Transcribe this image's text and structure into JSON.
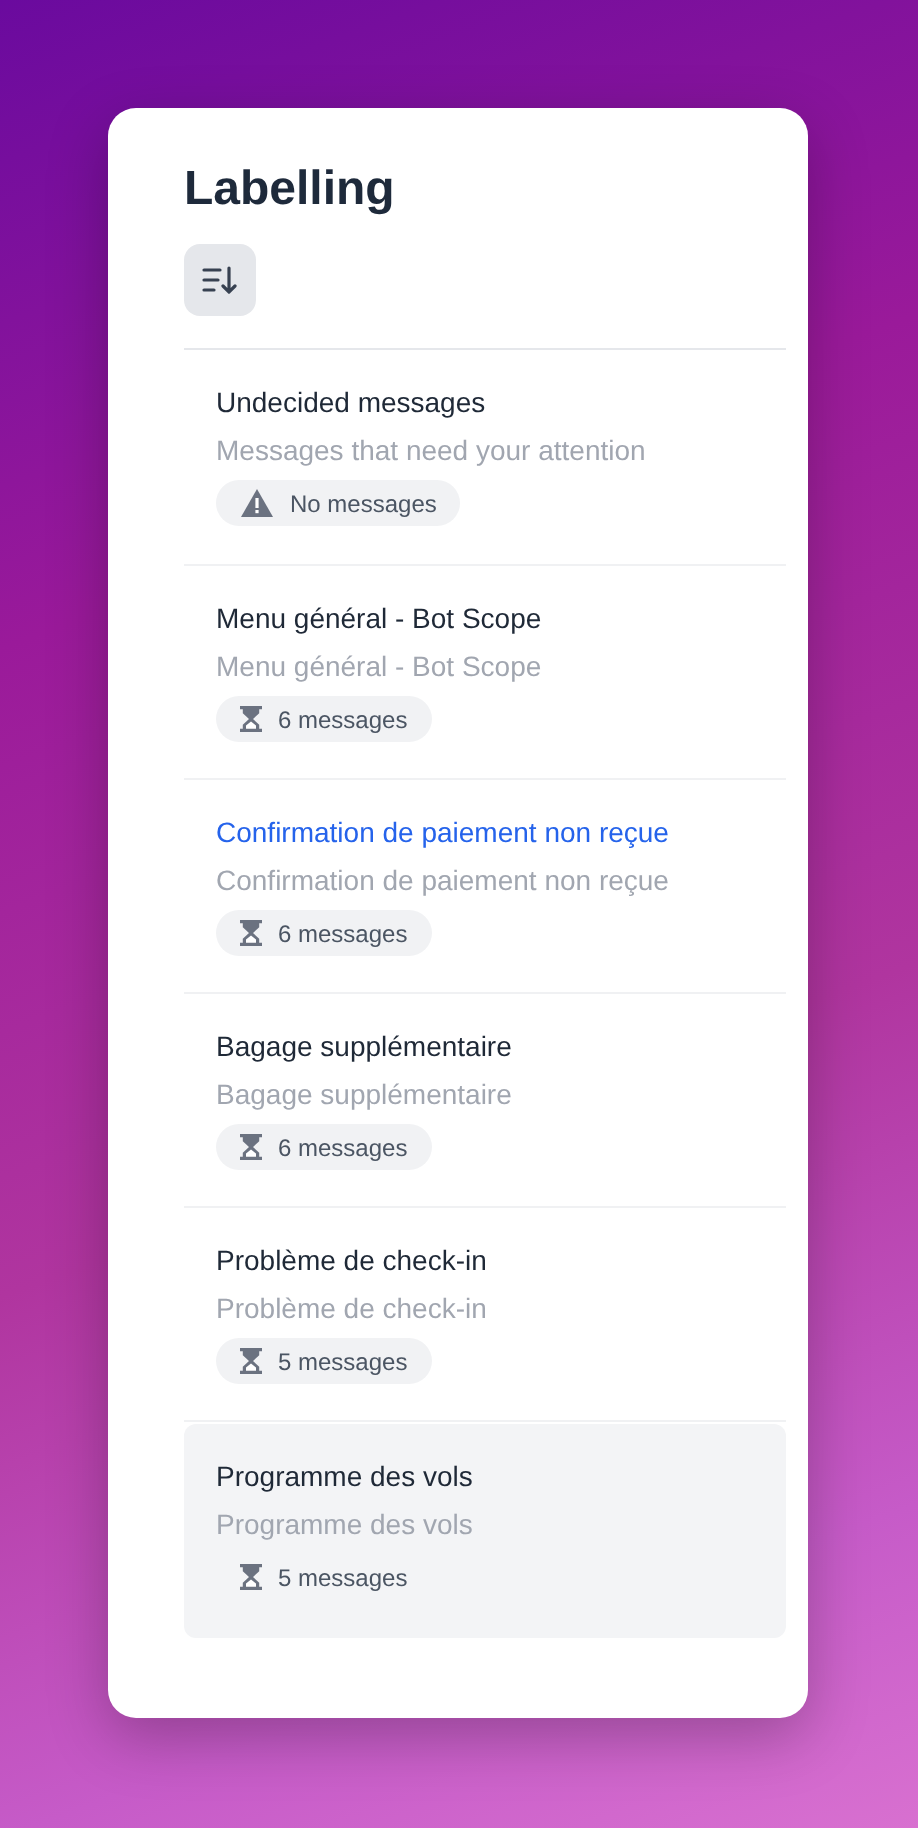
{
  "title": "Labelling",
  "items": [
    {
      "title": "Undecided messages",
      "subtitle": "Messages that need your attention",
      "badge": {
        "kind": "warning",
        "text": "No messages"
      },
      "selected": false,
      "hovered": false
    },
    {
      "title": "Menu général - Bot Scope",
      "subtitle": "Menu général - Bot Scope",
      "badge": {
        "kind": "pending",
        "text": "6 messages"
      },
      "selected": false,
      "hovered": false
    },
    {
      "title": "Confirmation de paiement non reçue",
      "subtitle": "Confirmation de paiement non reçue",
      "badge": {
        "kind": "pending",
        "text": "6 messages"
      },
      "selected": true,
      "hovered": false
    },
    {
      "title": "Bagage supplémentaire",
      "subtitle": "Bagage supplémentaire",
      "badge": {
        "kind": "pending",
        "text": "6 messages"
      },
      "selected": false,
      "hovered": false
    },
    {
      "title": "Problème de check-in",
      "subtitle": "Problème de check-in",
      "badge": {
        "kind": "pending",
        "text": "5 messages"
      },
      "selected": false,
      "hovered": false
    },
    {
      "title": "Programme des vols",
      "subtitle": "Programme des vols",
      "badge": {
        "kind": "pending",
        "text": "5 messages"
      },
      "selected": false,
      "hovered": true
    }
  ]
}
